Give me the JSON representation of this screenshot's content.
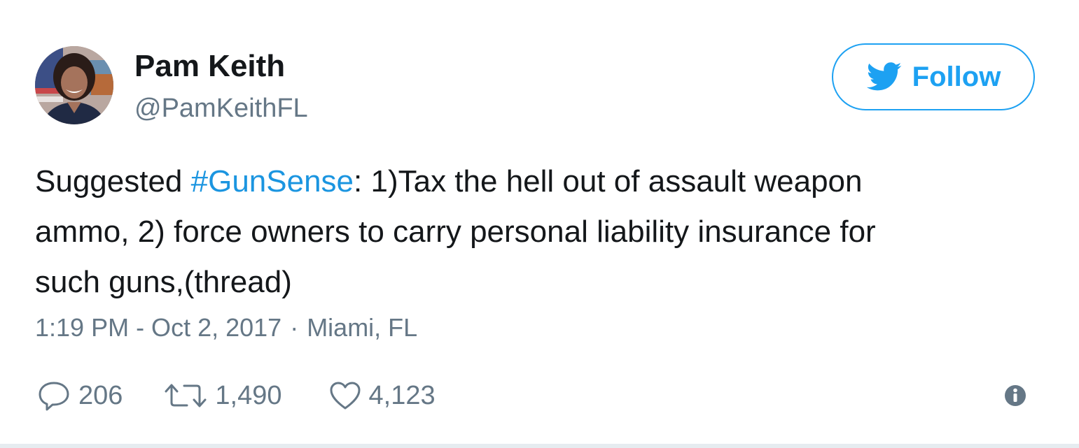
{
  "tweet": {
    "author_name": "Pam Keith",
    "author_handle": "@PamKeithFL",
    "follow_label": "Follow",
    "text_parts": {
      "prefix": "Suggested ",
      "hashtag": "#GunSense",
      "line1_rest": ": 1)Tax the hell out of assault weapon",
      "line2": "ammo, 2) force owners to carry personal liability insurance for",
      "line3": "such guns,(thread)"
    },
    "timestamp": "1:19 PM - Oct 2, 2017",
    "separator": "·",
    "location": "Miami, FL",
    "stats": {
      "replies": "206",
      "retweets": "1,490",
      "likes": "4,123"
    }
  },
  "icons": {
    "follow": "twitter-bird-icon",
    "reply": "speech-bubble-icon",
    "retweet": "retweet-arrows-icon",
    "like": "heart-icon",
    "info": "info-circle-icon"
  },
  "colors": {
    "brand_blue": "#1da1f2",
    "link_blue": "#1b95e0",
    "text": "#14171a",
    "muted": "#657786"
  }
}
